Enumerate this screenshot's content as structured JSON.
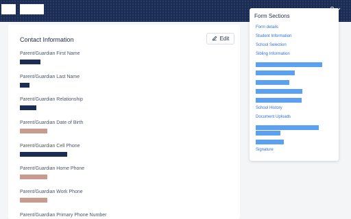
{
  "header": {
    "logo_icon": "logo-block",
    "brand_icon": "wordmark-block",
    "user_icon": "user-icon",
    "menu_icon": "chevron-down-icon"
  },
  "contact": {
    "title": "Contact Information",
    "edit_label": "Edit",
    "edit_icon": "pencil-icon",
    "fields": [
      {
        "label": "Parent/Guardian First Name"
      },
      {
        "label": "Parent/Guardian Last Name"
      },
      {
        "label": "Parent/Guardian Relationship"
      },
      {
        "label": "Parent/Guardian Date of Birth"
      },
      {
        "label": "Parent/Guardian Cell Phone"
      },
      {
        "label": "Parent/Guardian Home Phone"
      },
      {
        "label": "Parent/Guardian Work Phone"
      },
      {
        "label": "Parent/Guardian Primary Phone Number"
      }
    ]
  },
  "form_sections": {
    "title": "Form Sections",
    "links": [
      "Form details",
      "Student Information",
      "School Selection",
      "Sibling Information",
      "School History",
      "Document Uploads",
      "Signature"
    ]
  },
  "colors": {
    "header_bg": "#1b2d55",
    "link": "#2f6fd6",
    "redacted_link": "#5ca1f0",
    "redacted_value_dark": "#1b2d55",
    "redacted_value_light": "#c99a8e"
  }
}
